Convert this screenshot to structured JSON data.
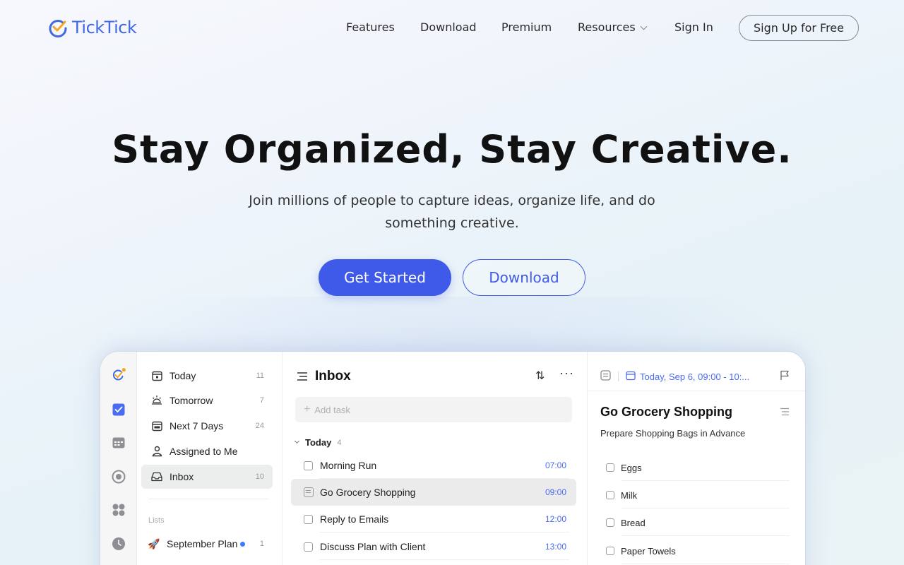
{
  "brand": {
    "name": "TickTick",
    "accent": "#4169e1",
    "badge_color": "#f5a623"
  },
  "nav": {
    "features": "Features",
    "download": "Download",
    "premium": "Premium",
    "resources": "Resources",
    "signin": "Sign In",
    "signup": "Sign Up for Free"
  },
  "hero": {
    "title": "Stay Organized, Stay Creative.",
    "subtitle": "Join millions of people to capture ideas, organize life, and do something creative.",
    "primary_cta": "Get Started",
    "secondary_cta": "Download"
  },
  "app": {
    "rail_icons": [
      "avatar",
      "task-check-icon",
      "calendar-icon",
      "focus-icon",
      "grid-icon",
      "clock-icon"
    ],
    "sidebar": {
      "items": [
        {
          "label": "Today",
          "count": "11",
          "icon": "today-icon"
        },
        {
          "label": "Tomorrow",
          "count": "7",
          "icon": "sun-icon"
        },
        {
          "label": "Next 7 Days",
          "count": "24",
          "icon": "week-icon"
        },
        {
          "label": "Assigned to Me",
          "count": "",
          "icon": "person-icon"
        },
        {
          "label": "Inbox",
          "count": "10",
          "icon": "inbox-icon"
        }
      ],
      "lists_heading": "Lists",
      "lists": [
        {
          "emoji": "🚀",
          "label": "September Plan",
          "count": "1",
          "dot_color": "#3a7bff"
        }
      ]
    },
    "list": {
      "title": "Inbox",
      "add_placeholder": "Add task",
      "group": {
        "label": "Today",
        "count": "4"
      },
      "tasks": [
        {
          "title": "Morning Run",
          "time": "07:00"
        },
        {
          "title": "Go Grocery Shopping",
          "time": "09:00"
        },
        {
          "title": "Reply to Emails",
          "time": "12:00"
        },
        {
          "title": "Discuss Plan with Client",
          "time": "13:00"
        }
      ]
    },
    "detail": {
      "date": "Today, Sep 6, 09:00 - 10:...",
      "title": "Go Grocery Shopping",
      "subtitle": "Prepare Shopping Bags in Advance",
      "checklist": [
        "Eggs",
        "Milk",
        "Bread",
        "Paper Towels"
      ]
    }
  }
}
